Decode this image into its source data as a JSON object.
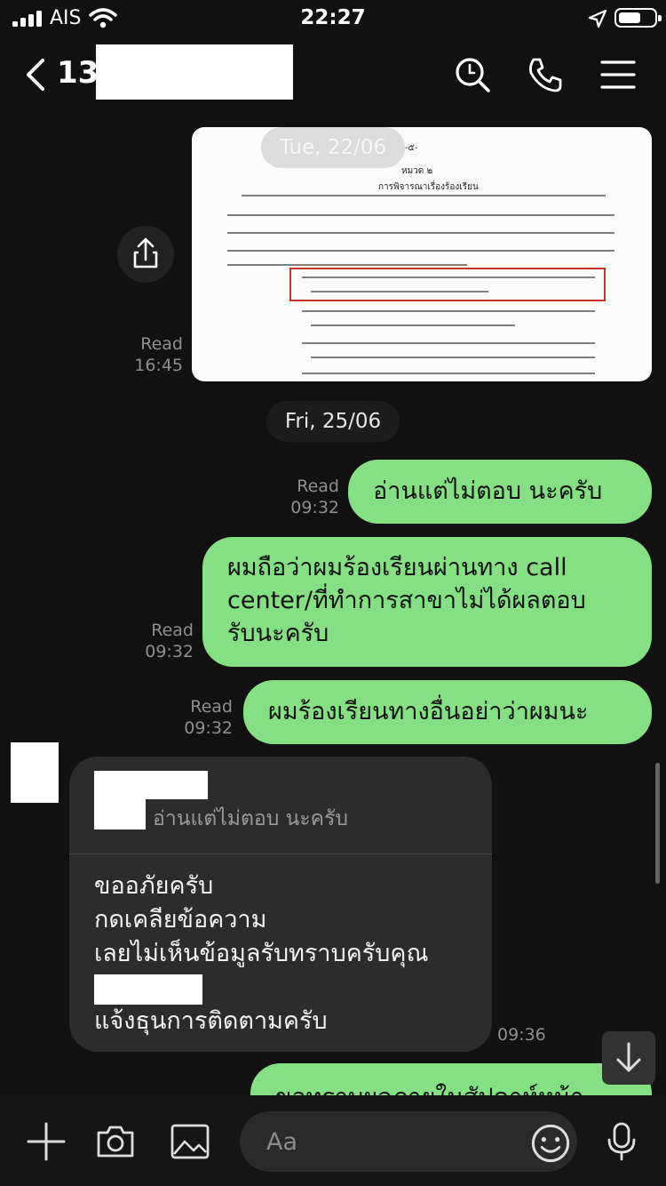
{
  "status_bar": {
    "carrier": "AIS",
    "time": "22:27"
  },
  "header": {
    "title": "13"
  },
  "messages": {
    "date1": "Tue, 22/06",
    "date2": "Fri, 25/06",
    "img_read": "Read",
    "img_time": "16:45",
    "m1": {
      "text": "อ่านแต่ไม่ตอบ นะครับ",
      "read": "Read",
      "time": "09:32"
    },
    "m2": {
      "lines": [
        "ผมถือว่าผมร้องเรียนผ่านทาง   call",
        "center/ที่ทำการสาขาไม่ได้ผลตอบ",
        "รับนะครับ"
      ],
      "read": "Read",
      "time": "09:32"
    },
    "m3": {
      "text": "ผมร้องเรียนทางอื่นอย่าว่าผมนะ",
      "read": "Read",
      "time": "09:32"
    },
    "reply": {
      "quoted": "อ่านแต่ไม่ตอบ นะครับ",
      "lines": [
        "ขออภัยครับ",
        "กดเคลียข้อความ",
        "เลยไม่เห็นข้อมูลรับทราบครับคุณ",
        "แจ้งธุนการติดตามครับ"
      ],
      "time": "09:36"
    },
    "m4_partial": "ขอทราบผลภายในสัปดาห์หน้า"
  },
  "document": {
    "page_mark": "-๕-",
    "heading": "หมวด ๒",
    "subheading": "การพิจารณาเรื่องร้องเรียน"
  },
  "input": {
    "placeholder": "Aa"
  },
  "colors": {
    "bubble_outgoing": "#85e084",
    "bubble_incoming": "#2c2c2c",
    "background": "#111111",
    "highlight_box": "#c0392b"
  }
}
